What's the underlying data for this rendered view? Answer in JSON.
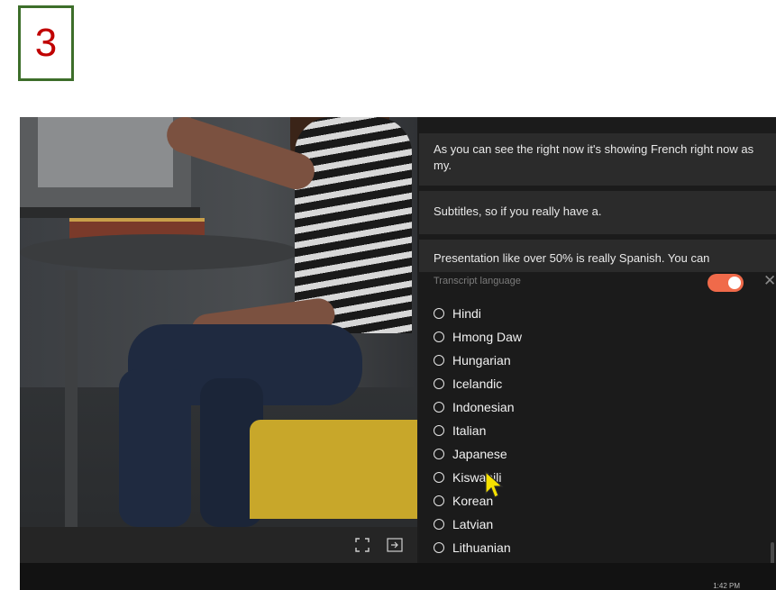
{
  "step_badge": "3",
  "captions": [
    "As you can see the right now it's showing French right now as my.",
    "Subtitles, so if you really have a.",
    "Presentation like over 50% is really Spanish. You can"
  ],
  "language_menu": {
    "header": "Transcript language",
    "toggle_on": true,
    "toggle_color": "#f06a4a",
    "items": [
      "Hindi",
      "Hmong Daw",
      "Hungarian",
      "Icelandic",
      "Indonesian",
      "Italian",
      "Japanese",
      "Kiswahili",
      "Korean",
      "Latvian",
      "Lithuanian"
    ]
  },
  "video_controls": {
    "fullscreen_icon": "expand-icon",
    "popout_icon": "popout-icon"
  },
  "taskbar": {
    "time": "1:42 PM"
  }
}
